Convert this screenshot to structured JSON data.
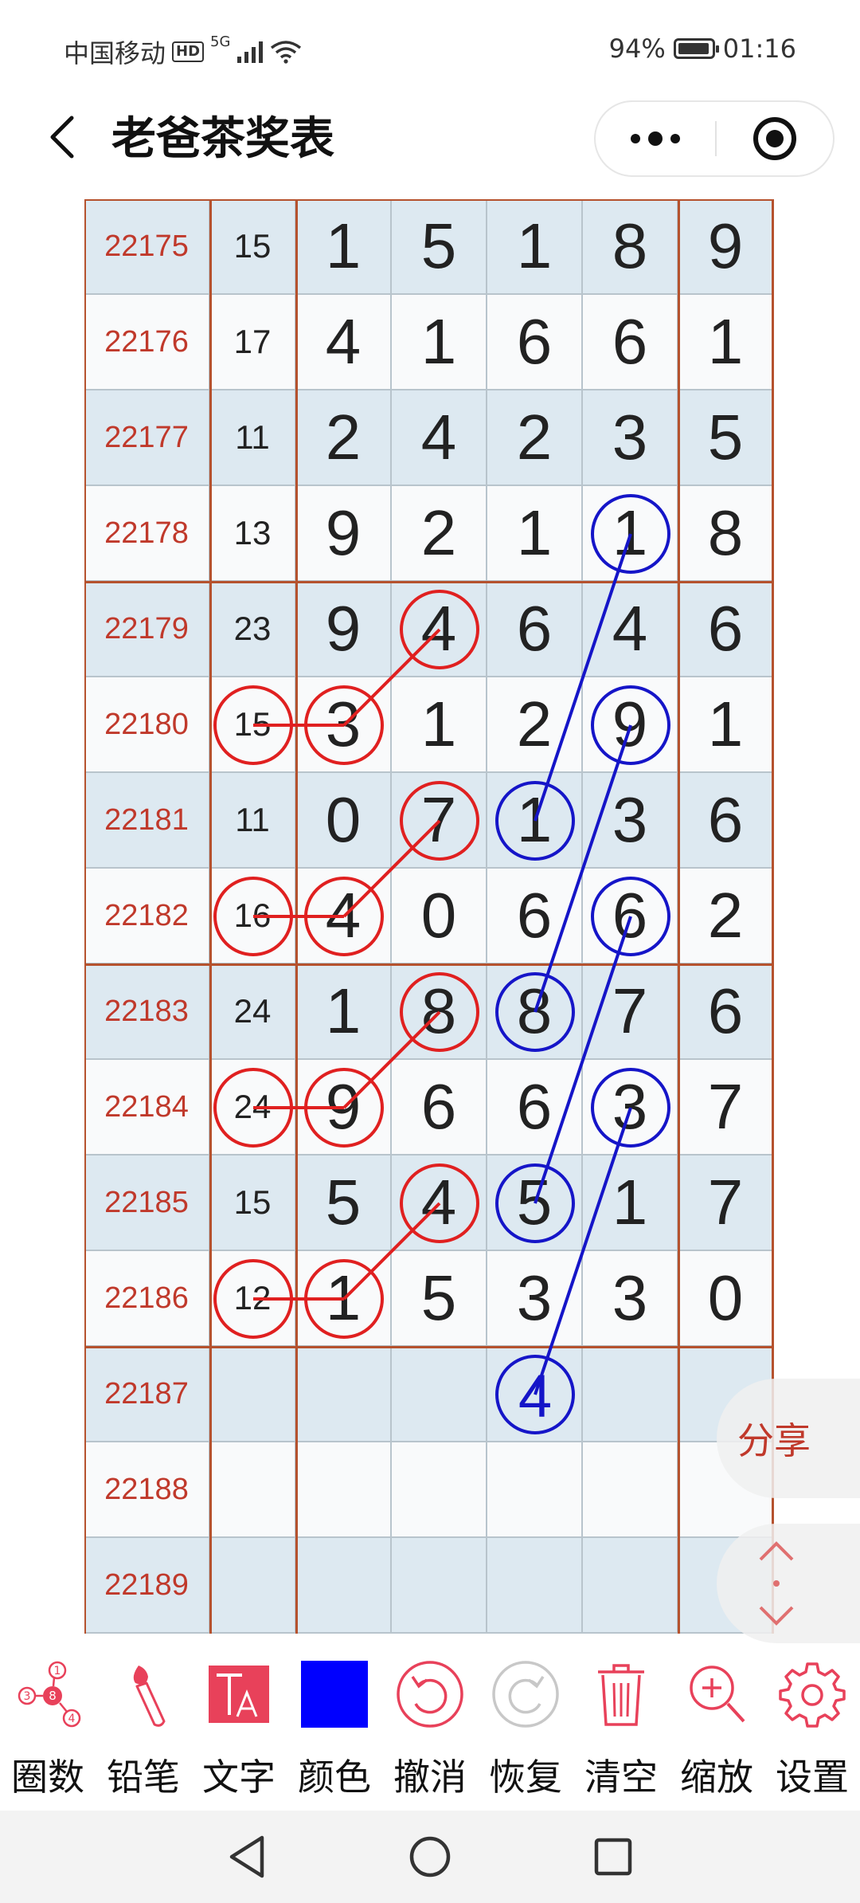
{
  "status": {
    "carrier": "中国移动",
    "hd": "HD",
    "network": "5G",
    "battery": "94%",
    "time": "01:16"
  },
  "nav": {
    "title": "老爸茶奖表"
  },
  "table": {
    "rows": [
      {
        "issue": "22175",
        "sum": "15",
        "d": [
          "1",
          "5",
          "1",
          "8"
        ],
        "e": "9"
      },
      {
        "issue": "22176",
        "sum": "17",
        "d": [
          "4",
          "1",
          "6",
          "6"
        ],
        "e": "1"
      },
      {
        "issue": "22177",
        "sum": "11",
        "d": [
          "2",
          "4",
          "2",
          "3"
        ],
        "e": "5"
      },
      {
        "issue": "22178",
        "sum": "13",
        "d": [
          "9",
          "2",
          "1",
          "1"
        ],
        "e": "8"
      },
      {
        "issue": "22179",
        "sum": "23",
        "d": [
          "9",
          "4",
          "6",
          "4"
        ],
        "e": "6"
      },
      {
        "issue": "22180",
        "sum": "15",
        "d": [
          "3",
          "1",
          "2",
          "9"
        ],
        "e": "1"
      },
      {
        "issue": "22181",
        "sum": "11",
        "d": [
          "0",
          "7",
          "1",
          "3"
        ],
        "e": "6"
      },
      {
        "issue": "22182",
        "sum": "16",
        "d": [
          "4",
          "0",
          "6",
          "6"
        ],
        "e": "2"
      },
      {
        "issue": "22183",
        "sum": "24",
        "d": [
          "1",
          "8",
          "8",
          "7"
        ],
        "e": "6"
      },
      {
        "issue": "22184",
        "sum": "24",
        "d": [
          "9",
          "6",
          "6",
          "3"
        ],
        "e": "7"
      },
      {
        "issue": "22185",
        "sum": "15",
        "d": [
          "5",
          "4",
          "5",
          "1"
        ],
        "e": "7"
      },
      {
        "issue": "22186",
        "sum": "12",
        "d": [
          "1",
          "5",
          "3",
          "3"
        ],
        "e": "0"
      },
      {
        "issue": "22187",
        "sum": "",
        "d": [
          "",
          "",
          "",
          ""
        ],
        "e": ""
      },
      {
        "issue": "22188",
        "sum": "",
        "d": [
          "",
          "",
          "",
          ""
        ],
        "e": ""
      },
      {
        "issue": "22189",
        "sum": "",
        "d": [
          "",
          "",
          "",
          ""
        ],
        "e": ""
      }
    ],
    "row_colors": {
      "shaded": "#dde9f1",
      "plain": "#f9fafb",
      "divider": "#b5522e"
    }
  },
  "annotations": {
    "red_color": "#e02020",
    "blue_color": "#1515c8",
    "red_circles": [
      {
        "row": 4,
        "col": 3
      },
      {
        "row": 5,
        "col": 1
      },
      {
        "row": 5,
        "col": 2
      },
      {
        "row": 6,
        "col": 3
      },
      {
        "row": 7,
        "col": 1
      },
      {
        "row": 7,
        "col": 2
      },
      {
        "row": 8,
        "col": 3
      },
      {
        "row": 9,
        "col": 1
      },
      {
        "row": 9,
        "col": 2
      },
      {
        "row": 10,
        "col": 3
      },
      {
        "row": 11,
        "col": 1
      },
      {
        "row": 11,
        "col": 2
      }
    ],
    "blue_circles": [
      {
        "row": 3,
        "col": 5
      },
      {
        "row": 5,
        "col": 5
      },
      {
        "row": 6,
        "col": 4
      },
      {
        "row": 7,
        "col": 5
      },
      {
        "row": 8,
        "col": 4
      },
      {
        "row": 9,
        "col": 5
      },
      {
        "row": 10,
        "col": 4
      },
      {
        "row": 12,
        "col": 4,
        "text": "4"
      }
    ],
    "red_lines": [
      {
        "from": {
          "row": 4,
          "col": 3
        },
        "to": {
          "row": 5,
          "col": 2
        }
      },
      {
        "from": {
          "row": 5,
          "col": 2
        },
        "to": {
          "row": 5,
          "col": 1
        }
      },
      {
        "from": {
          "row": 6,
          "col": 3
        },
        "to": {
          "row": 7,
          "col": 2
        }
      },
      {
        "from": {
          "row": 7,
          "col": 2
        },
        "to": {
          "row": 7,
          "col": 1
        }
      },
      {
        "from": {
          "row": 8,
          "col": 3
        },
        "to": {
          "row": 9,
          "col": 2
        }
      },
      {
        "from": {
          "row": 9,
          "col": 2
        },
        "to": {
          "row": 9,
          "col": 1
        }
      },
      {
        "from": {
          "row": 10,
          "col": 3
        },
        "to": {
          "row": 11,
          "col": 2
        }
      },
      {
        "from": {
          "row": 11,
          "col": 2
        },
        "to": {
          "row": 11,
          "col": 1
        }
      }
    ],
    "blue_lines": [
      {
        "from": {
          "row": 3,
          "col": 5
        },
        "to": {
          "row": 6,
          "col": 4
        }
      },
      {
        "from": {
          "row": 5,
          "col": 5
        },
        "to": {
          "row": 8,
          "col": 4
        }
      },
      {
        "from": {
          "row": 7,
          "col": 5
        },
        "to": {
          "row": 10,
          "col": 4
        }
      },
      {
        "from": {
          "row": 9,
          "col": 5
        },
        "to": {
          "row": 12,
          "col": 4
        }
      }
    ]
  },
  "floating": {
    "share": "分享"
  },
  "toolbar": {
    "items": [
      {
        "id": "circle",
        "label": "圈数",
        "icon": "circle-number-icon"
      },
      {
        "id": "pencil",
        "label": "铅笔",
        "icon": "brush-icon"
      },
      {
        "id": "text",
        "label": "文字",
        "icon": "text-icon"
      },
      {
        "id": "color",
        "label": "颜色",
        "icon": "color-swatch-icon",
        "color": "#0000ff"
      },
      {
        "id": "undo",
        "label": "撤消",
        "icon": "undo-icon"
      },
      {
        "id": "redo",
        "label": "恢复",
        "icon": "redo-icon"
      },
      {
        "id": "clear",
        "label": "清空",
        "icon": "trash-icon"
      },
      {
        "id": "zoom",
        "label": "缩放",
        "icon": "zoom-in-icon"
      },
      {
        "id": "settings",
        "label": "设置",
        "icon": "gear-icon"
      }
    ]
  }
}
